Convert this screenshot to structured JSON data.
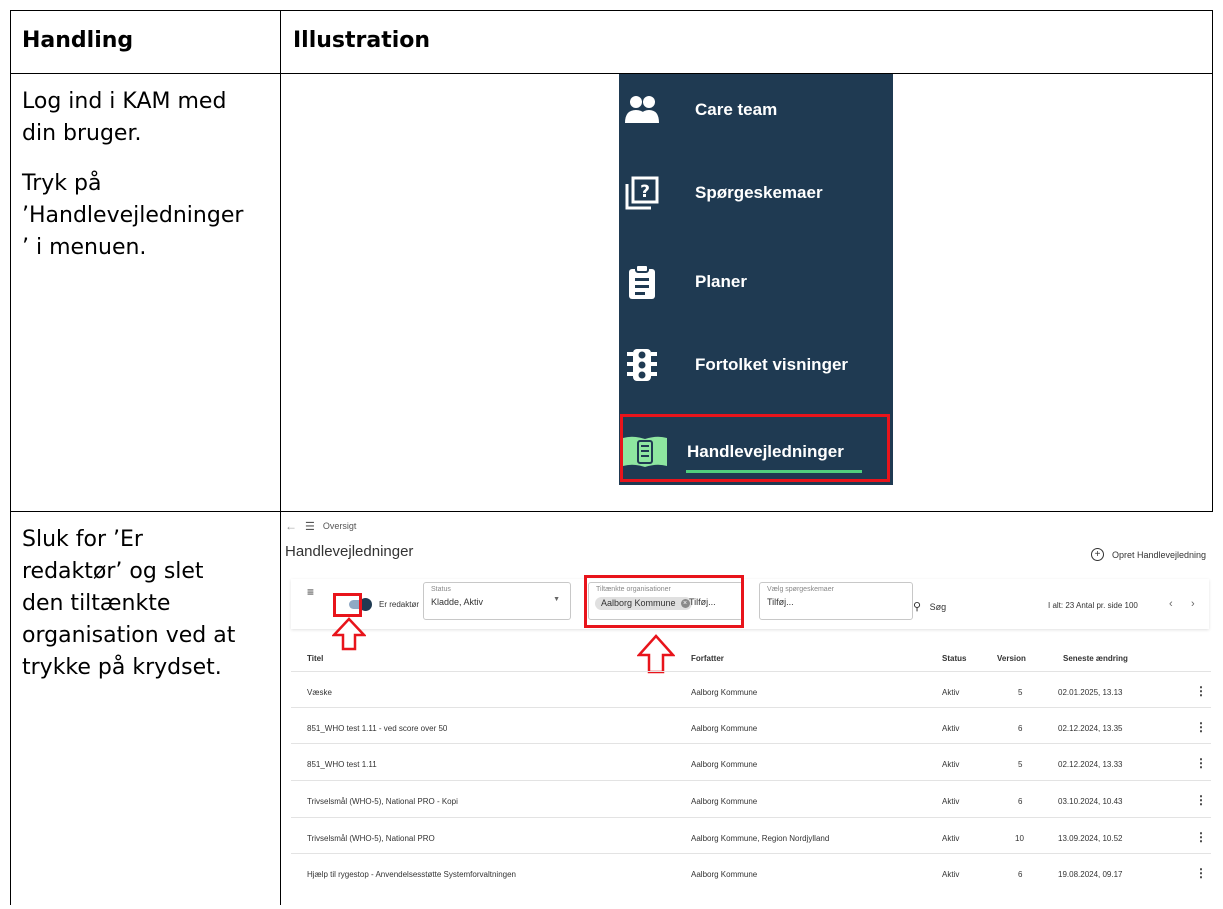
{
  "table": {
    "header_action": "Handling",
    "header_illustration": "Illustration"
  },
  "row1": {
    "paragraph1": "Log ind i KAM med din bruger.",
    "paragraph2_lines": [
      "Tryk på",
      "’Handlevejledninger",
      "’ i menuen."
    ]
  },
  "row2": {
    "lines": [
      "Sluk for ’Er",
      "redaktør’ og slet",
      "den tiltænkte",
      "organisation ved at",
      "trykke på krydset."
    ]
  },
  "menu": {
    "items": [
      {
        "label": "Care team",
        "icon": "people-icon"
      },
      {
        "label": "Spørgeskemaer",
        "icon": "question-stack-icon"
      },
      {
        "label": "Planer",
        "icon": "clipboard-icon"
      },
      {
        "label": "Fortolket visninger",
        "icon": "traffic-light-icon"
      },
      {
        "label": "Handlevejledninger",
        "icon": "book-icon"
      }
    ],
    "colors": {
      "background": "#1f3a52",
      "highlight": "#e8141b",
      "accent": "#4fd07d"
    }
  },
  "screenshot": {
    "nav_label": "Oversigt",
    "page_title": "Handlevejledninger",
    "create_label": "Opret Handlevejledning",
    "toggle_label": "Er redaktør",
    "status_field": {
      "label": "Status",
      "value": "Kladde, Aktiv"
    },
    "org_field": {
      "label": "Tiltænkte organisationer",
      "chip": "Aalborg Kommune",
      "placeholder": "Tilføj..."
    },
    "questionnaire_field": {
      "label": "Vælg spørgeskemaer",
      "placeholder": "Tilføj..."
    },
    "search_label": "Søg",
    "pagination": "I alt: 23 Antal pr. side 100",
    "columns": [
      "Titel",
      "Forfatter",
      "Status",
      "Version",
      "Seneste ændring"
    ],
    "rows": [
      {
        "title": "Væske",
        "author": "Aalborg Kommune",
        "status": "Aktiv",
        "version": "5",
        "changed": "02.01.2025, 13.13"
      },
      {
        "title": "851_WHO test 1.11 - ved score over 50",
        "author": "Aalborg Kommune",
        "status": "Aktiv",
        "version": "6",
        "changed": "02.12.2024, 13.35"
      },
      {
        "title": "851_WHO test 1.11",
        "author": "Aalborg Kommune",
        "status": "Aktiv",
        "version": "5",
        "changed": "02.12.2024, 13.33"
      },
      {
        "title": "Trivselsmål (WHO-5), National PRO - Kopi",
        "author": "Aalborg Kommune",
        "status": "Aktiv",
        "version": "6",
        "changed": "03.10.2024, 10.43"
      },
      {
        "title": "Trivselsmål (WHO-5), National PRO",
        "author": "Aalborg Kommune, Region Nordjylland",
        "status": "Aktiv",
        "version": "10",
        "changed": "13.09.2024, 10.52"
      },
      {
        "title": "Hjælp til rygestop - Anvendelsesstøtte Systemforvaltningen",
        "author": "Aalborg Kommune",
        "status": "Aktiv",
        "version": "6",
        "changed": "19.08.2024, 09.17"
      }
    ]
  }
}
